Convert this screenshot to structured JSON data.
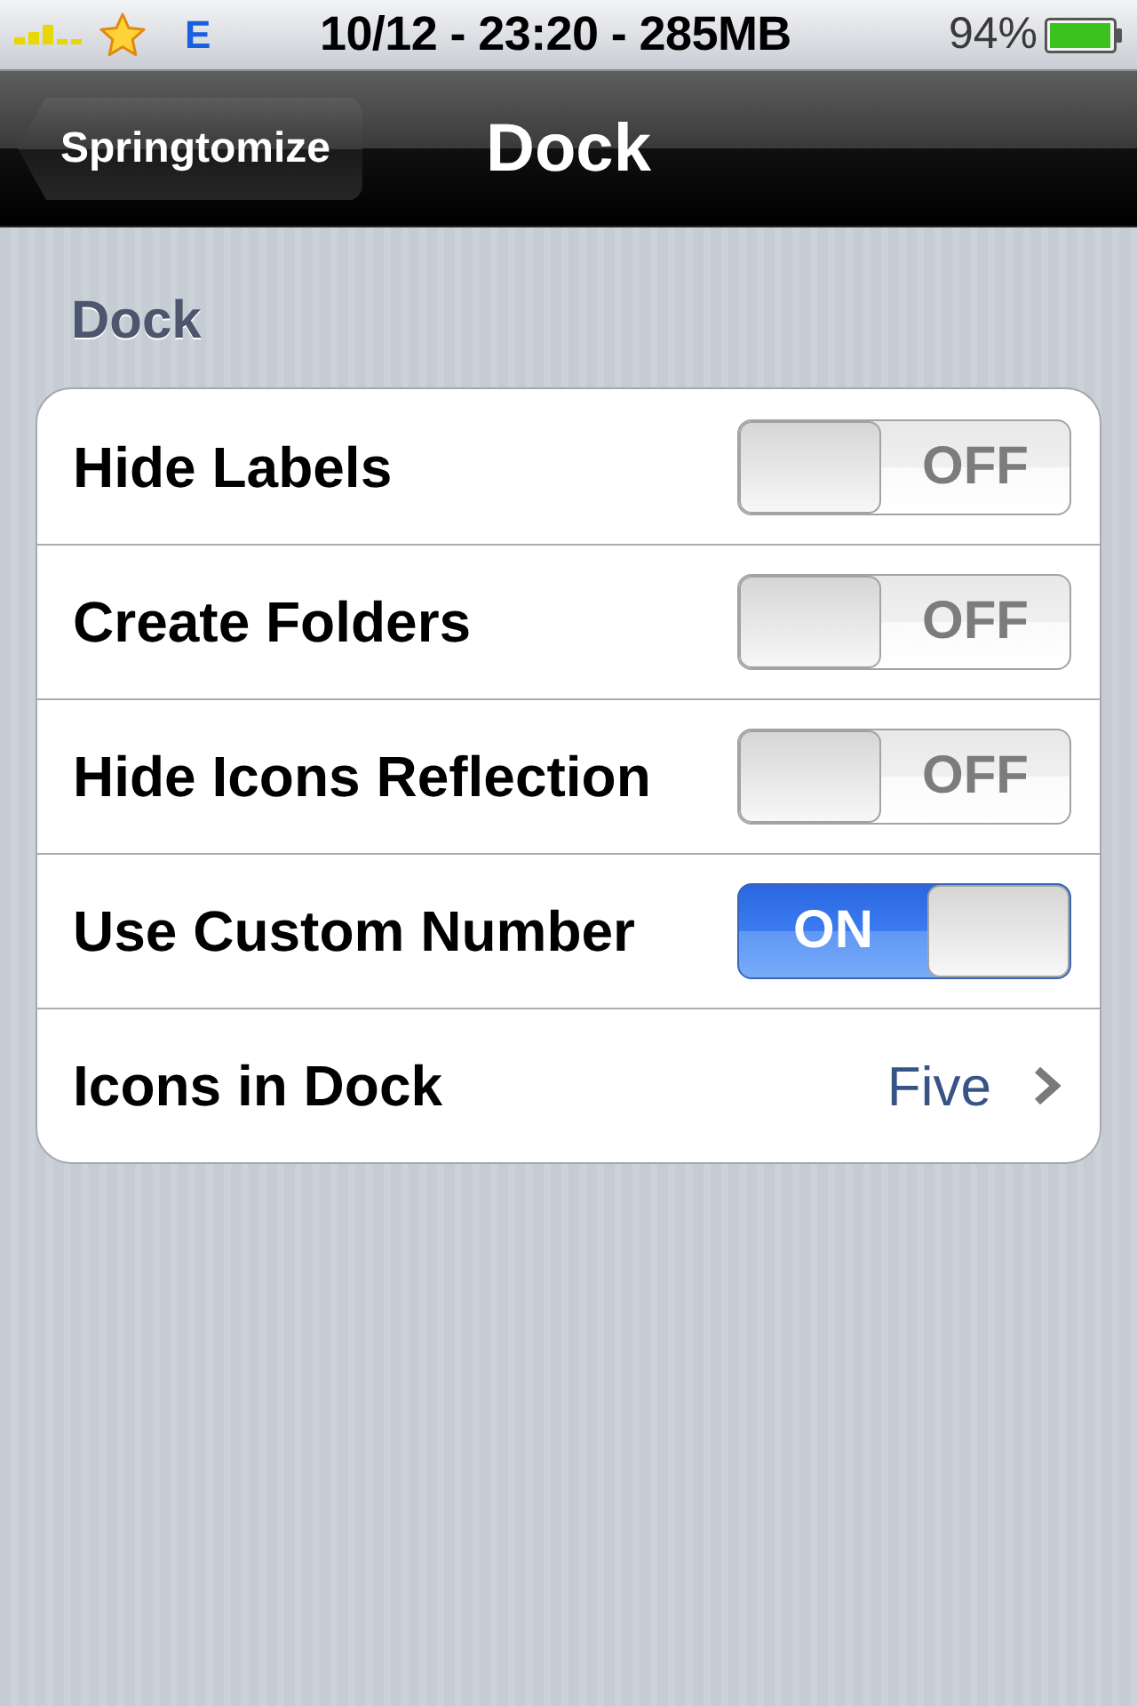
{
  "status_bar": {
    "network_label": "E",
    "time": "10/12 - 23:20 - 285MB",
    "battery": "94%"
  },
  "nav_bar": {
    "back_button": "Springtomize",
    "title": "Dock"
  },
  "section": {
    "header": "Dock",
    "rows": [
      {
        "kind": "switch",
        "label": "Hide Labels",
        "on": false,
        "switch_text": "OFF"
      },
      {
        "kind": "switch",
        "label": "Create Folders",
        "on": false,
        "switch_text": "OFF"
      },
      {
        "kind": "switch",
        "label": "Hide Icons Reflection",
        "on": false,
        "switch_text": "OFF"
      },
      {
        "kind": "switch",
        "label": "Use Custom Number",
        "on": true,
        "switch_text": "ON"
      },
      {
        "kind": "disclosure",
        "label": "Icons in Dock",
        "value": "Five"
      }
    ]
  }
}
